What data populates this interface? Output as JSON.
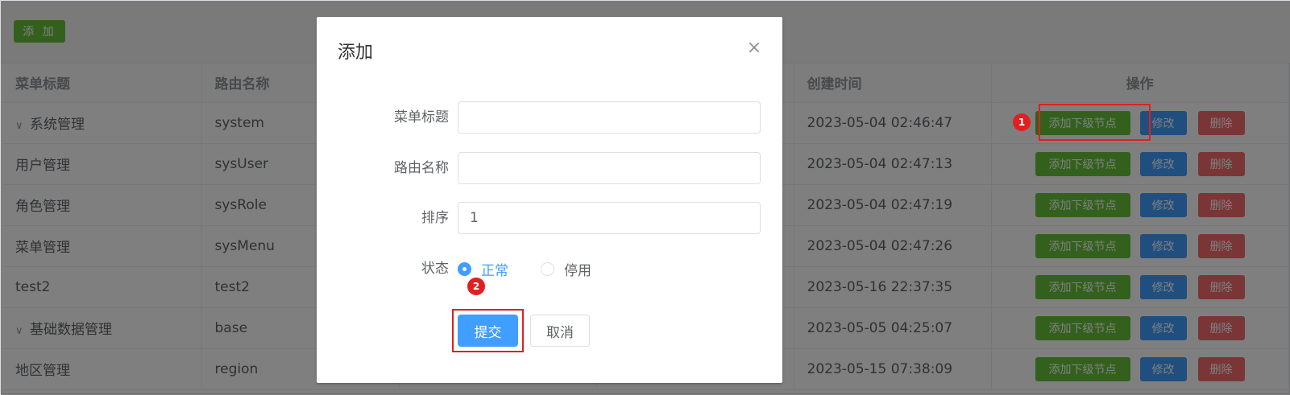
{
  "toolbar": {
    "add_label": "添 加"
  },
  "table": {
    "columns": [
      "菜单标题",
      "路由名称",
      "",
      "",
      "创建时间",
      "操作"
    ],
    "rows": [
      {
        "title": "系统管理",
        "route": "system",
        "created": "2023-05-04 02:46:47",
        "expanded": true
      },
      {
        "title": "用户管理",
        "route": "sysUser",
        "created": "2023-05-04 02:47:13"
      },
      {
        "title": "角色管理",
        "route": "sysRole",
        "created": "2023-05-04 02:47:19"
      },
      {
        "title": "菜单管理",
        "route": "sysMenu",
        "created": "2023-05-04 02:47:26"
      },
      {
        "title": "test2",
        "route": "test2",
        "created": "2023-05-16 22:37:35"
      },
      {
        "title": "基础数据管理",
        "route": "base",
        "created": "2023-05-05 04:25:07",
        "expanded": true
      },
      {
        "title": "地区管理",
        "route": "region",
        "created": "2023-05-15 07:38:09"
      }
    ],
    "actions": {
      "add_child": "添加下级节点",
      "edit": "修改",
      "delete": "删除"
    }
  },
  "dialog": {
    "title": "添加",
    "close_icon": "close-icon",
    "fields": {
      "title_label": "菜单标题",
      "title_value": "",
      "route_label": "路由名称",
      "route_value": "",
      "sort_label": "排序",
      "sort_value": "1",
      "status_label": "状态",
      "status_options": [
        "正常",
        "停用"
      ],
      "status_selected": "正常"
    },
    "submit_label": "提交",
    "cancel_label": "取消"
  },
  "annotations": {
    "step1": "1",
    "step2": "2",
    "highlight_color": "#e02020"
  }
}
